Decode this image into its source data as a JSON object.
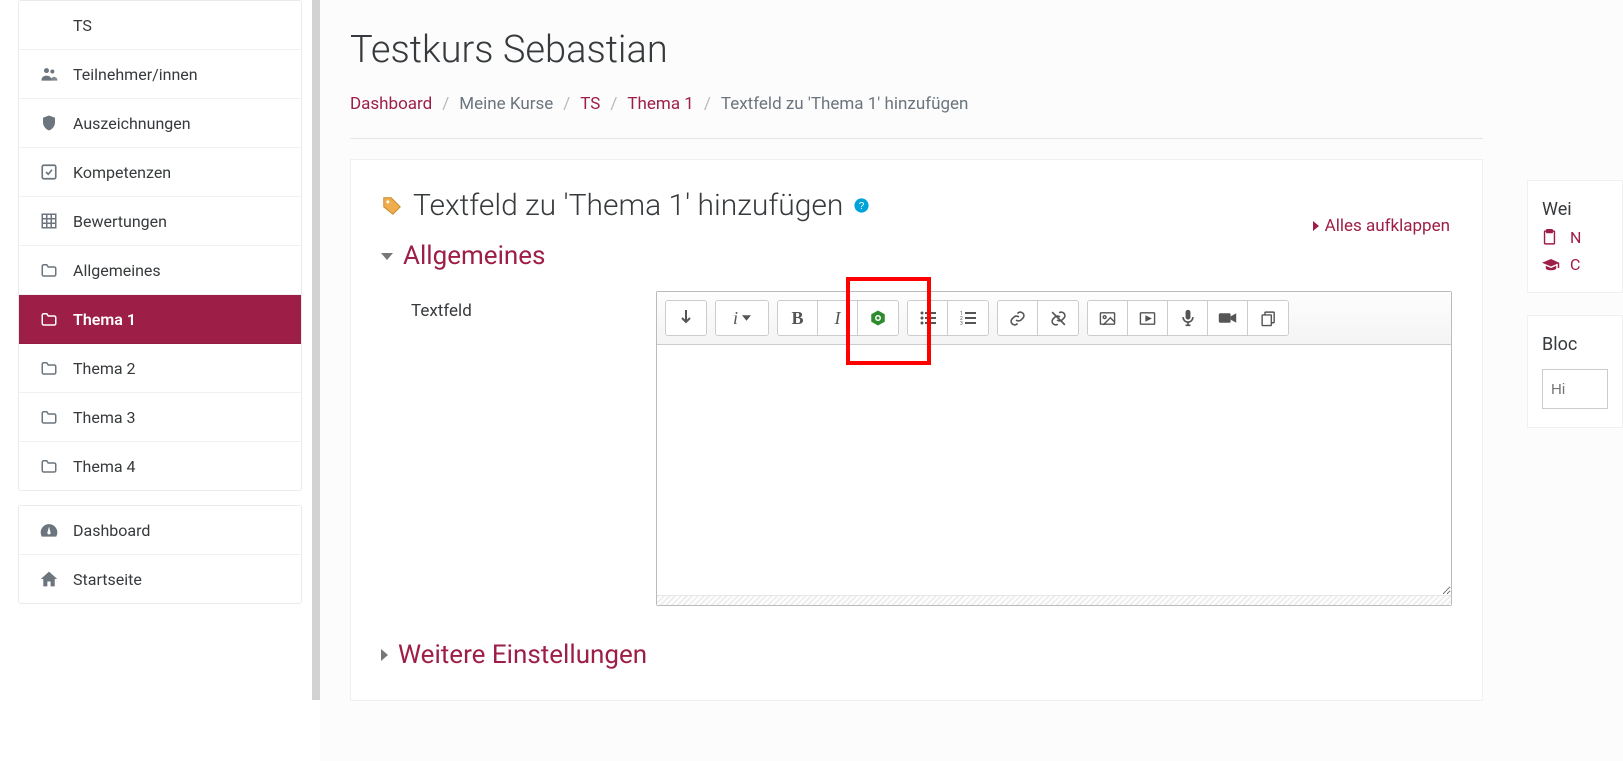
{
  "sidebar": {
    "block1": [
      {
        "icon": "text",
        "label": "TS"
      },
      {
        "icon": "users",
        "label": "Teilnehmer/innen"
      },
      {
        "icon": "shield",
        "label": "Auszeichnungen"
      },
      {
        "icon": "check-square",
        "label": "Kompetenzen"
      },
      {
        "icon": "grid",
        "label": "Bewertungen"
      },
      {
        "icon": "folder",
        "label": "Allgemeines"
      },
      {
        "icon": "folder",
        "label": "Thema 1",
        "active": true
      },
      {
        "icon": "folder",
        "label": "Thema 2"
      },
      {
        "icon": "folder",
        "label": "Thema 3"
      },
      {
        "icon": "folder",
        "label": "Thema 4"
      }
    ],
    "block2": [
      {
        "icon": "gauge",
        "label": "Dashboard"
      },
      {
        "icon": "home",
        "label": "Startseite"
      }
    ]
  },
  "page_title": "Testkurs Sebastian",
  "breadcrumb": [
    {
      "label": "Dashboard",
      "link": true
    },
    {
      "label": "Meine Kurse",
      "link": false
    },
    {
      "label": "TS",
      "link": true
    },
    {
      "label": "Thema 1",
      "link": true
    },
    {
      "label": "Textfeld zu 'Thema 1' hinzufügen",
      "link": false
    }
  ],
  "form": {
    "heading": "Textfeld zu 'Thema 1' hinzufügen",
    "expand_all": "Alles aufklappen",
    "section_general": "Allgemeines",
    "field_textfeld_label": "Textfeld",
    "section_more": "Weitere Einstellungen"
  },
  "right": {
    "block1_title": "Wei",
    "block1_link1": "N",
    "block1_link2": "C",
    "block2_title": "Bloc",
    "block2_placeholder": "Hi"
  }
}
